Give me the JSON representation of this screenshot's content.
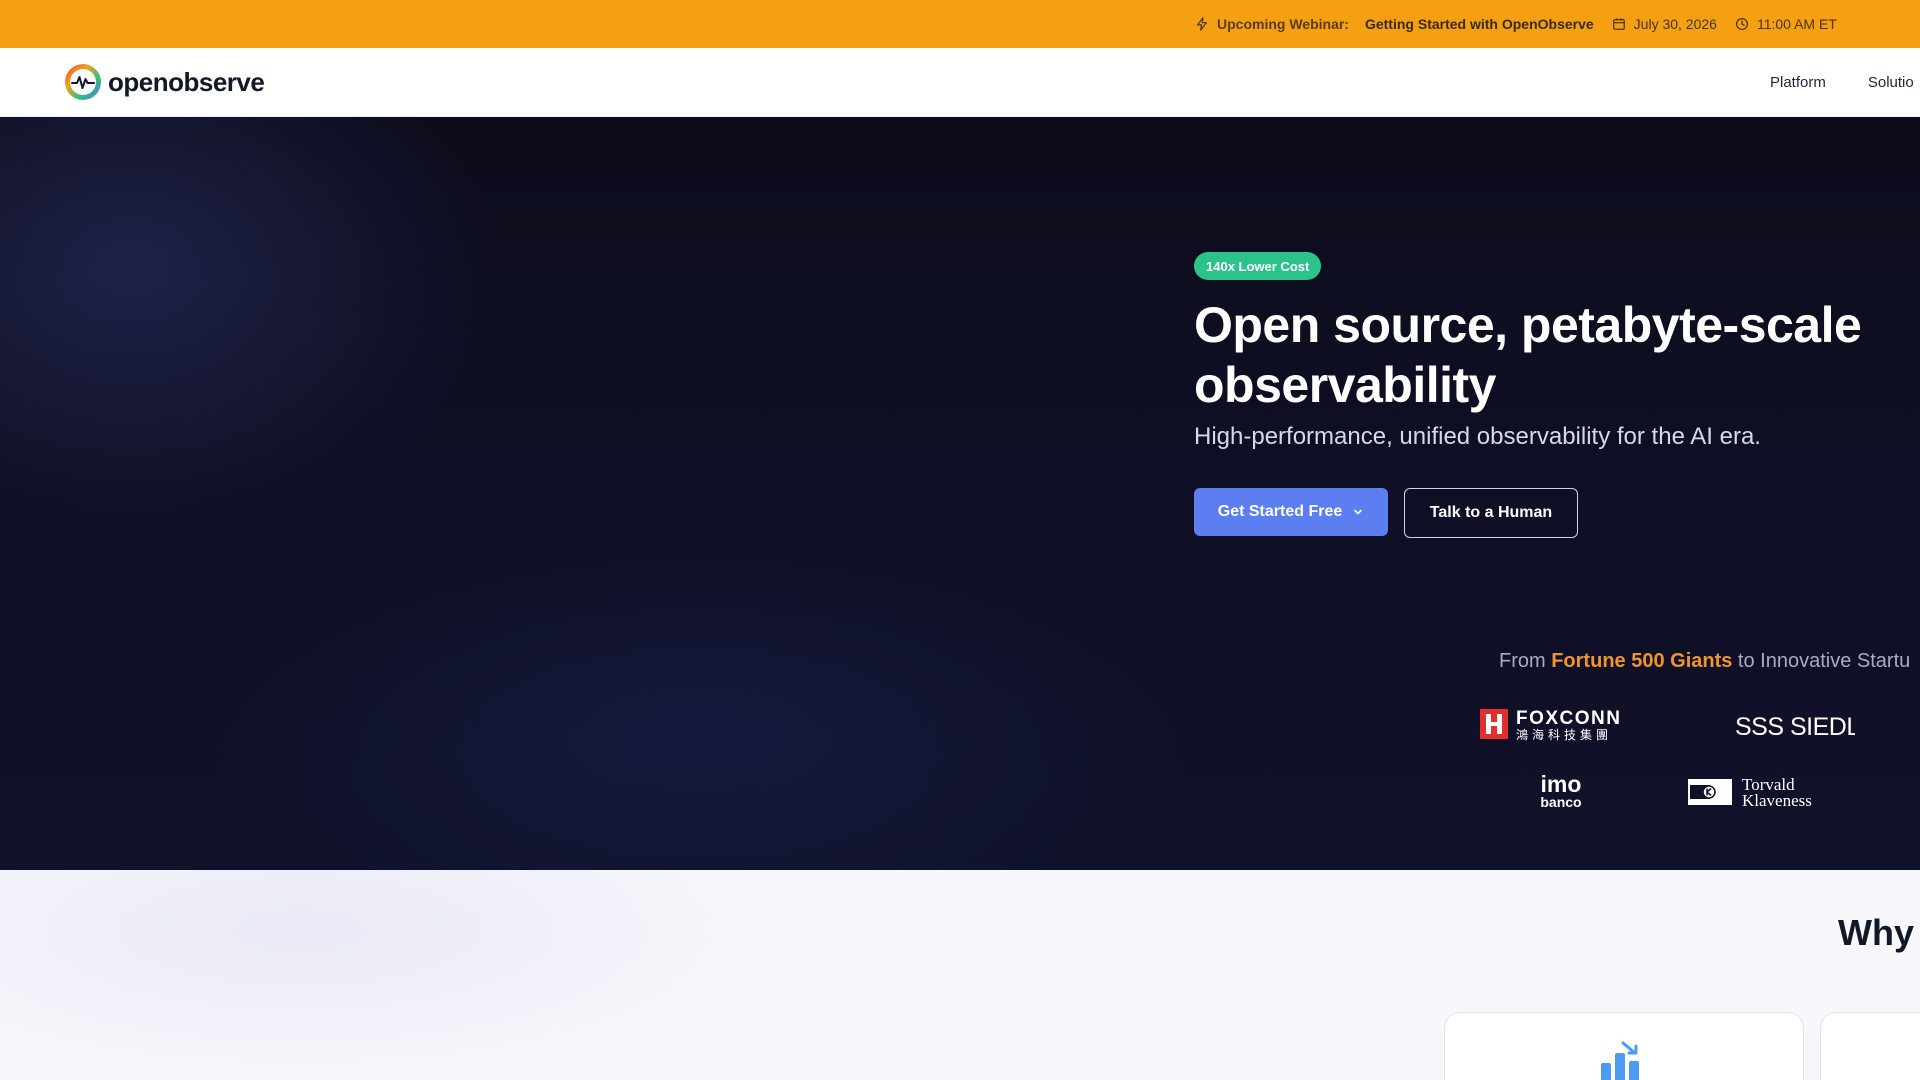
{
  "announcement": {
    "lead": "Upcoming Webinar:",
    "title": "Getting Started with OpenObserve",
    "date": "July 30, 2026",
    "time": "11:00 AM ET"
  },
  "navbar": {
    "brand": "openobserve",
    "links": [
      "Platform",
      "Solutio"
    ]
  },
  "hero": {
    "badge": "140x Lower Cost",
    "title_line1": "Open source, petabyte-scale",
    "title_line2": "observability",
    "subtitle": "High-performance, unified observability for the AI era.",
    "primary_cta": "Get Started Free",
    "secondary_cta": "Talk to a Human",
    "trust_prefix": "From ",
    "trust_highlight": "Fortune 500 Giants",
    "trust_suffix": " to Innovative Startu",
    "logos": {
      "foxconn_name": "FOXCONN",
      "foxconn_sub": "鴻海科技集團",
      "siedle": "SSS SIEDLE",
      "imo_top": "imo",
      "imo_bottom": "banco",
      "torvald_line1": "Torvald",
      "torvald_line2": "Klaveness"
    }
  },
  "why": {
    "title": "Why"
  },
  "colors": {
    "announcement_bg": "#f5a013",
    "hero_bg": "#0f1026",
    "badge_bg": "#2cc38a",
    "primary_button": "#5b7ff0",
    "highlight": "#f0952b"
  },
  "icons": [
    "bolt-icon",
    "calendar-icon",
    "clock-icon",
    "chevron-down-icon",
    "brand-logo-icon",
    "chart-icon"
  ]
}
